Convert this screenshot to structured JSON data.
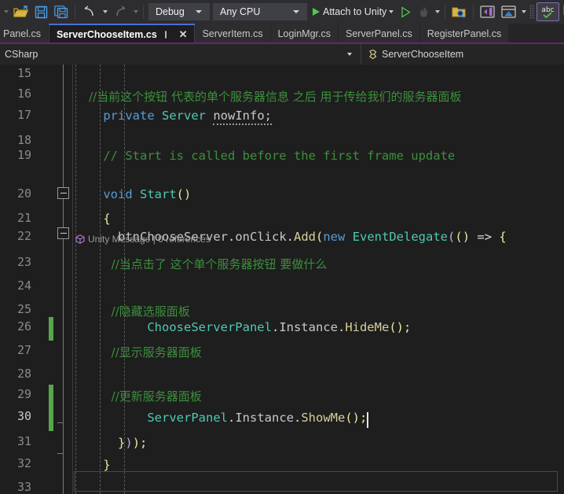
{
  "toolbar": {
    "icons": [
      {
        "name": "open-file-icon",
        "glyph": "folder-open"
      },
      {
        "name": "save-icon",
        "glyph": "floppy"
      },
      {
        "name": "save-all-icon",
        "glyph": "floppy-stack"
      },
      {
        "name": "undo-icon",
        "glyph": "undo-arrow"
      },
      {
        "name": "redo-icon",
        "glyph": "redo-arrow"
      }
    ],
    "config_combo": {
      "label": "Debug",
      "name": "solution-configuration-combo"
    },
    "platform_combo": {
      "label": "Any CPU",
      "name": "solution-platform-combo"
    },
    "attach_label": "Attach to Unity",
    "right_icons": [
      {
        "name": "find-in-files-icon",
        "glyph": "folder-search"
      },
      {
        "name": "solution-explorer-icon",
        "glyph": "vs-window"
      },
      {
        "name": "properties-window-icon",
        "glyph": "window-home"
      },
      {
        "name": "spell-check-icon",
        "glyph": "abc-check",
        "active": true
      },
      {
        "name": "pointer-ruler-icon",
        "glyph": "pointer-ruler"
      },
      {
        "name": "task-list-icon",
        "glyph": "list-panel"
      }
    ]
  },
  "tabs": [
    {
      "label": "Panel.cs",
      "active": false,
      "truncated": true
    },
    {
      "label": "ServerChooseItem.cs",
      "active": true,
      "pin": "pin-icon",
      "close": "close-icon"
    },
    {
      "label": "ServerItem.cs",
      "active": false
    },
    {
      "label": "LoginMgr.cs",
      "active": false
    },
    {
      "label": "ServerPanel.cs",
      "active": false
    },
    {
      "label": "RegisterPanel.cs",
      "active": false
    }
  ],
  "navbar": {
    "project": "CSharp",
    "type_member": "ServerChooseItem"
  },
  "editor": {
    "codelens": {
      "icon": "unity-cube-icon",
      "text": "Unity Message | 0 references"
    },
    "cursor_line": 30,
    "lines": [
      {
        "num": 15,
        "segments": []
      },
      {
        "num": 16,
        "segments": [
          {
            "t": "    //当前这个按钮 代表的单个服务器信息 之后 用于传给我们的服务器面板",
            "c": "tok-cmt-zh"
          }
        ]
      },
      {
        "num": 17,
        "segments": [
          {
            "t": "    ",
            "c": "tok-plain"
          },
          {
            "t": "private",
            "c": "tok-kw"
          },
          {
            "t": " ",
            "c": "tok-plain"
          },
          {
            "t": "Server",
            "c": "tok-type"
          },
          {
            "t": " ",
            "c": "tok-plain"
          },
          {
            "t": "nowInfo;",
            "c": "tok-ident",
            "u": true
          }
        ]
      },
      {
        "num": 18,
        "segments": []
      },
      {
        "num": 19,
        "segments": [
          {
            "t": "    // Start is called before the first frame update",
            "c": "tok-cmt"
          }
        ]
      },
      {
        "num": 20,
        "segments": [
          {
            "t": "    ",
            "c": "tok-plain"
          },
          {
            "t": "void",
            "c": "tok-kw"
          },
          {
            "t": " ",
            "c": "tok-plain"
          },
          {
            "t": "Start",
            "c": "tok-type"
          },
          {
            "t": "()",
            "c": "tok-brace1"
          }
        ]
      },
      {
        "num": 21,
        "segments": [
          {
            "t": "    ",
            "c": "tok-plain"
          },
          {
            "t": "{",
            "c": "tok-brace1"
          }
        ]
      },
      {
        "num": 22,
        "segments": [
          {
            "t": "      ",
            "c": "tok-plain"
          },
          {
            "t": "btnChooseServer",
            "c": "tok-ident"
          },
          {
            "t": ".",
            "c": "tok-punct"
          },
          {
            "t": "onClick",
            "c": "tok-ident"
          },
          {
            "t": ".",
            "c": "tok-punct"
          },
          {
            "t": "Add",
            "c": "tok-method"
          },
          {
            "t": "(",
            "c": "tok-brace1"
          },
          {
            "t": "new",
            "c": "tok-kw"
          },
          {
            "t": " ",
            "c": "tok-plain"
          },
          {
            "t": "EventDelegate",
            "c": "tok-type"
          },
          {
            "t": "(",
            "c": "tok-brace2"
          },
          {
            "t": "()",
            "c": "tok-brace1"
          },
          {
            "t": " => ",
            "c": "tok-plain"
          },
          {
            "t": "{",
            "c": "tok-brace1"
          }
        ]
      },
      {
        "num": 23,
        "segments": [
          {
            "t": "          //当点击了 这个单个服务器按钮 要做什么",
            "c": "tok-cmt-zh"
          }
        ]
      },
      {
        "num": 24,
        "segments": []
      },
      {
        "num": 25,
        "segments": [
          {
            "t": "          //隐藏选服面板",
            "c": "tok-cmt-zh"
          }
        ]
      },
      {
        "num": 26,
        "segments": [
          {
            "t": "          ",
            "c": "tok-plain"
          },
          {
            "t": "ChooseServerPanel",
            "c": "tok-type"
          },
          {
            "t": ".",
            "c": "tok-punct"
          },
          {
            "t": "Instance",
            "c": "tok-ident"
          },
          {
            "t": ".",
            "c": "tok-punct"
          },
          {
            "t": "HideMe",
            "c": "tok-method"
          },
          {
            "t": "();",
            "c": "tok-brace1"
          }
        ]
      },
      {
        "num": 27,
        "segments": [
          {
            "t": "          //显示服务器面板",
            "c": "tok-cmt-zh"
          }
        ]
      },
      {
        "num": 28,
        "segments": []
      },
      {
        "num": 29,
        "segments": [
          {
            "t": "          //更新服务器面板",
            "c": "tok-cmt-zh"
          }
        ]
      },
      {
        "num": 30,
        "segments": [
          {
            "t": "          ",
            "c": "tok-plain"
          },
          {
            "t": "ServerPanel",
            "c": "tok-type"
          },
          {
            "t": ".",
            "c": "tok-punct"
          },
          {
            "t": "Instance",
            "c": "tok-ident"
          },
          {
            "t": ".",
            "c": "tok-punct"
          },
          {
            "t": "ShowMe",
            "c": "tok-method"
          },
          {
            "t": "();",
            "c": "tok-brace1"
          }
        ]
      },
      {
        "num": 31,
        "segments": [
          {
            "t": "      ",
            "c": "tok-plain"
          },
          {
            "t": "}",
            "c": "tok-brace1"
          },
          {
            "t": ")",
            "c": "tok-brace2"
          },
          {
            "t": ");",
            "c": "tok-brace1"
          }
        ]
      },
      {
        "num": 32,
        "segments": [
          {
            "t": "    ",
            "c": "tok-plain"
          },
          {
            "t": "}",
            "c": "tok-brace1"
          }
        ]
      },
      {
        "num": 33,
        "segments": []
      }
    ],
    "change_bars": [
      {
        "line": 26,
        "span": 1
      },
      {
        "line": 29,
        "span": 2
      }
    ]
  },
  "colors": {
    "background": "#1e1e1e",
    "chrome": "#2d2d30",
    "tabbar": "#252526",
    "accent_purple": "#68217a",
    "active_tab_rule": "#4a6fd4",
    "comment_green": "#3d8f3d",
    "keyword_blue": "#569cd6",
    "type_teal": "#4ec9b0",
    "method_yellow": "#d6cf9a",
    "change_bar_green": "#57a64a"
  }
}
